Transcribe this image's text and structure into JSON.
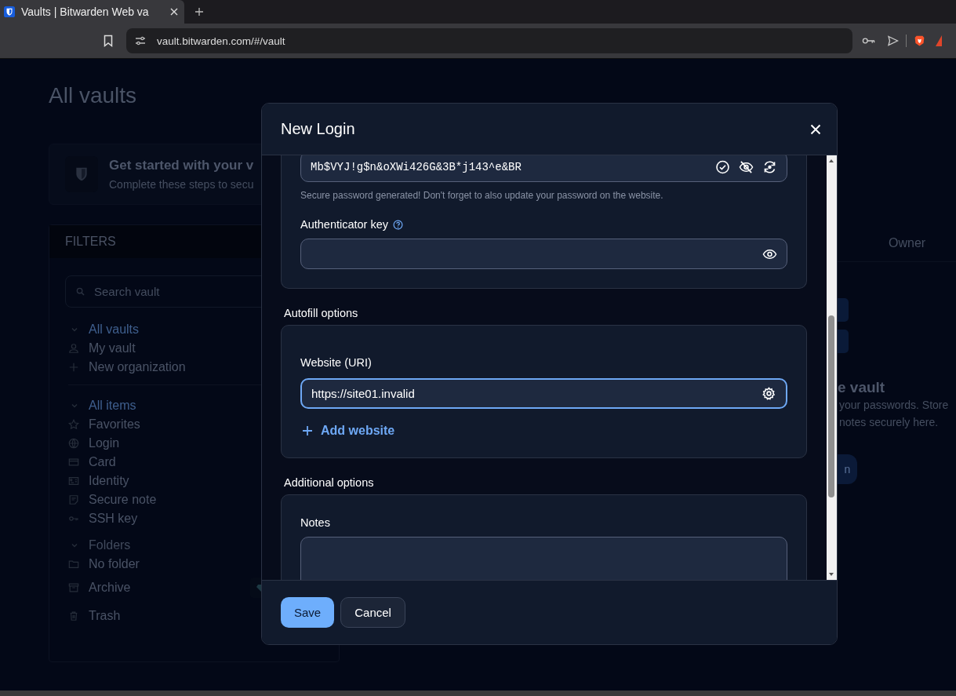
{
  "browser": {
    "tab": {
      "title": "Vaults | Bitwarden Web va",
      "selected": true
    },
    "url": "vault.bitwarden.com/#/vault"
  },
  "page": {
    "title": "All vaults",
    "banner": {
      "title": "Get started with your v",
      "subtitle": "Complete these steps to secu"
    },
    "filters": {
      "heading": "FILTERS",
      "search": {
        "placeholder": "Search vault"
      },
      "groups": [
        {
          "label": "All vaults",
          "expanded": true,
          "selected": true,
          "children": [
            {
              "label": "My vault",
              "kind": "user",
              "selected": false
            },
            {
              "label": "New organization",
              "kind": "plus",
              "selected": false
            }
          ]
        },
        {
          "label": "All items",
          "expanded": true,
          "selected": true,
          "children": [
            {
              "label": "Favorites",
              "kind": "star",
              "selected": false
            },
            {
              "label": "Login",
              "kind": "globe",
              "selected": false
            },
            {
              "label": "Card",
              "kind": "card",
              "selected": false
            },
            {
              "label": "Identity",
              "kind": "id",
              "selected": false
            },
            {
              "label": "Secure note",
              "kind": "note",
              "selected": false
            },
            {
              "label": "SSH key",
              "kind": "key",
              "selected": false
            }
          ]
        },
        {
          "label": "Folders",
          "expanded": true,
          "selected": false,
          "children": [
            {
              "label": "No folder",
              "kind": "folder",
              "selected": false
            }
          ]
        }
      ],
      "extras": [
        {
          "label": "Archive",
          "kind": "archive",
          "premium": true,
          "selected": false
        },
        {
          "label": "Trash",
          "kind": "trash",
          "premium": false,
          "selected": false
        }
      ]
    },
    "owner_column": "Owner",
    "empty_state": {
      "title": "e vault",
      "lines": [
        "your passwords. Store",
        "notes securely here."
      ],
      "button": "n"
    }
  },
  "dialog": {
    "title": "New Login",
    "password": {
      "value": "Mb$VYJ!g$n&oXWi426G&3B*j143^e&BR",
      "hint": "Secure password generated! Don't forget to also update your password on the website."
    },
    "authenticator": {
      "label": "Authenticator key"
    },
    "autofill": {
      "heading": "Autofill options",
      "uri_label": "Website (URI)",
      "uri_value": "https://site01.invalid",
      "focused": true,
      "add_button": "Add website"
    },
    "additional": {
      "heading": "Additional options",
      "notes_label": "Notes"
    },
    "buttons": {
      "save": "Save",
      "cancel": "Cancel"
    }
  }
}
